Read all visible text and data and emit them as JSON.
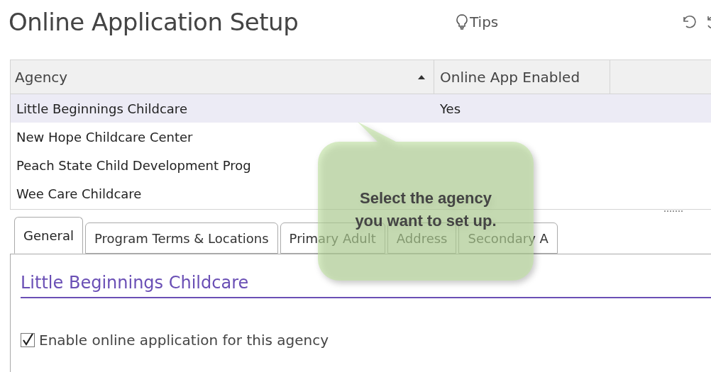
{
  "page": {
    "title": "Online Application Setup",
    "tips": "Tips"
  },
  "table": {
    "columns": [
      "Agency",
      "Online App Enabled"
    ],
    "rows": [
      {
        "agency": "Little Beginnings Childcare",
        "enabled": "Yes",
        "selected": true
      },
      {
        "agency": "New Hope Childcare Center",
        "enabled": "",
        "selected": false
      },
      {
        "agency": "Peach State Child Development Prog",
        "enabled": "",
        "selected": false
      },
      {
        "agency": "Wee Care Childcare",
        "enabled": "",
        "selected": false
      }
    ]
  },
  "tabs": [
    {
      "label": "General",
      "selected": true
    },
    {
      "label": "Program Terms & Locations",
      "selected": false
    },
    {
      "label": "Primary Adult",
      "selected": false
    },
    {
      "label": "Address",
      "selected": false
    },
    {
      "label": "Secondary A",
      "selected": false
    }
  ],
  "general": {
    "heading": "Little Beginnings Childcare",
    "enable_label": "Enable online application for this agency",
    "enable_checked": true
  },
  "callout": {
    "text": "Select the agency you want to set up."
  }
}
